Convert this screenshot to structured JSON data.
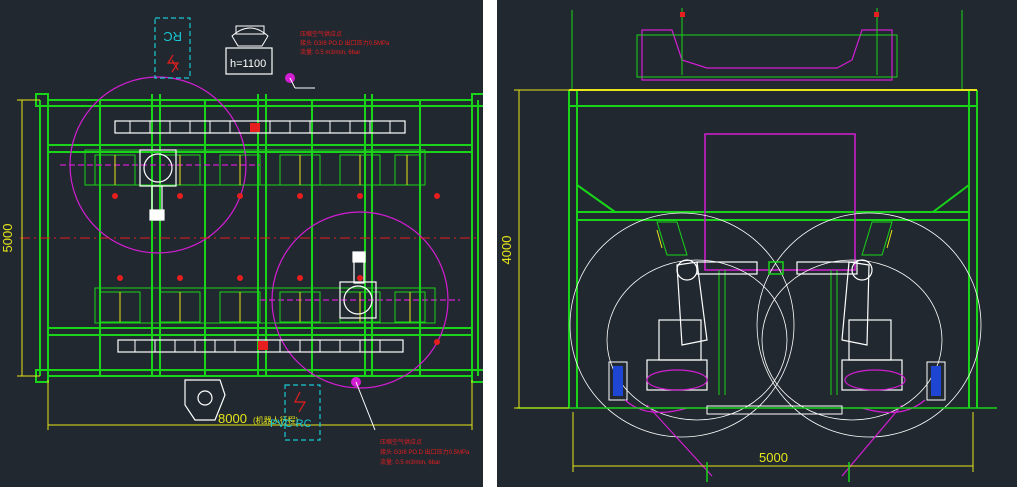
{
  "left_view": {
    "height_label": "h=1100",
    "rc_label": "RC",
    "rc_label_bottom": "PVC RC",
    "dim_width": "8000",
    "dim_width_suffix": "(机器人行程)",
    "dim_height": "5000",
    "note_top": [
      "压缩空气供应点",
      "接头 G3/8 PO.D 出口压力0.5MPa",
      "流量: 0.5 m3/min, 6bar"
    ],
    "note_bottom": [
      "压缩空气供应点",
      "接头 G3/8 PO.D 出口压力0.5MPa",
      "流量: 0.5 m3/min, 6bar"
    ]
  },
  "right_view": {
    "dim_height": "4000",
    "dim_width": "5000"
  },
  "colors": {
    "background": "#212830",
    "frame_green": "#19d419",
    "magenta": "#d21ed2",
    "white": "#ffffff",
    "yellow": "#e6e619",
    "red": "#e61e1e",
    "cyan": "#19c8d2",
    "blue": "#1e46d2"
  }
}
